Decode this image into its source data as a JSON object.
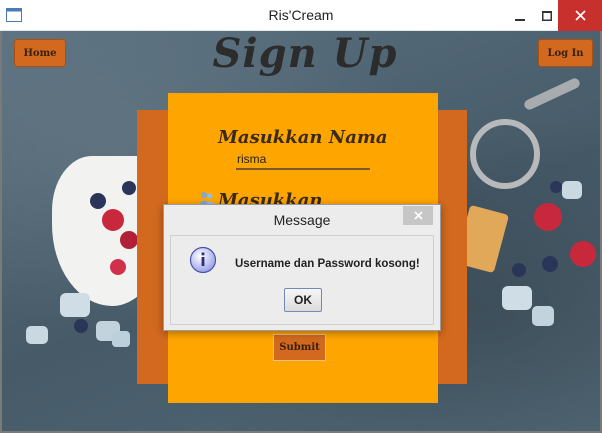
{
  "window": {
    "title": "Ris'Cream"
  },
  "header": {
    "home_label": "Home",
    "login_label": "Log In",
    "page_title": "Sign Up"
  },
  "form": {
    "name_label": "Masukkan Nama",
    "name_value": "risma",
    "username_label": "Masukkan Username",
    "submit_label": "Submit"
  },
  "dialog": {
    "title": "Message",
    "close_glyph": "✕",
    "message": "Username dan Password kosong!",
    "ok_label": "OK"
  },
  "colors": {
    "accent_orange": "#ffa500",
    "dark_orange": "#d2691e",
    "close_red": "#c7302d"
  }
}
